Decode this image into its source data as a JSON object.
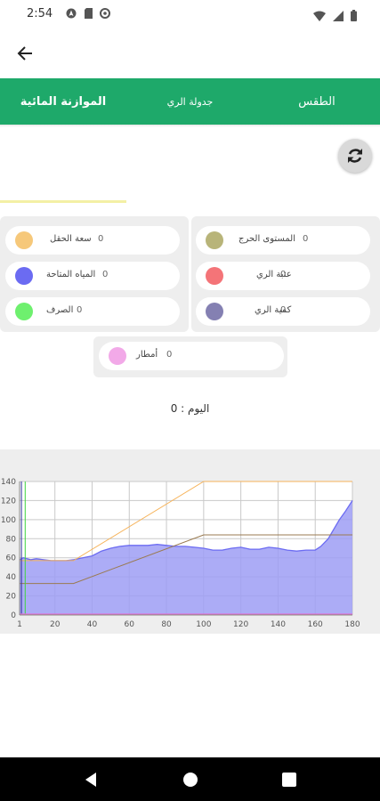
{
  "status_bar": {
    "time": "2:54"
  },
  "tabs": [
    {
      "label": "الموازنة المائية",
      "active": true
    },
    {
      "label": "جدولة الري",
      "active": false
    },
    {
      "label": "الطقس",
      "active": false
    }
  ],
  "legend": {
    "left": [
      {
        "label": "سعة الحقل",
        "value": "0",
        "color": "#f6c87a"
      },
      {
        "label": "المياه المتاحة",
        "value": "0",
        "color": "#6b6bf2"
      },
      {
        "label": "الصرف",
        "value": "0",
        "color": "#6ef06e"
      }
    ],
    "right": [
      {
        "label": "المستوى الحرج",
        "value": "0",
        "color": "#b8b479"
      },
      {
        "label": "عتبة الري",
        "value": "0",
        "color": "#f47478"
      },
      {
        "label": "كمية الري",
        "value": "0",
        "color": "#8480b2"
      }
    ],
    "bottom": {
      "label": "أمطار",
      "value": "0",
      "color": "#f2a9e8"
    }
  },
  "day_text": "اليوم : 0",
  "chart_data": {
    "type": "line",
    "title": "",
    "xlabel": "",
    "ylabel": "",
    "xlim": [
      1,
      180
    ],
    "ylim": [
      0,
      140
    ],
    "x_ticks": [
      "1",
      "20",
      "40",
      "60",
      "80",
      "100",
      "120",
      "140",
      "160",
      "180"
    ],
    "y_ticks": [
      "0",
      "20",
      "40",
      "60",
      "80",
      "100",
      "120",
      "140"
    ],
    "grid": true,
    "series": [
      {
        "name": "المياه المتاحة",
        "type": "area",
        "color": "#6b6bf2",
        "x": [
          1,
          3,
          5,
          7,
          10,
          14,
          18,
          22,
          26,
          30,
          35,
          40,
          45,
          50,
          55,
          60,
          65,
          70,
          75,
          80,
          85,
          90,
          95,
          100,
          105,
          110,
          115,
          120,
          125,
          130,
          135,
          140,
          145,
          150,
          155,
          160,
          163,
          167,
          170,
          173,
          176,
          180
        ],
        "y": [
          58,
          60,
          59,
          58,
          59,
          58,
          57,
          57,
          57,
          58,
          60,
          62,
          67,
          70,
          72,
          73,
          73,
          73,
          74,
          73,
          72,
          72,
          71,
          70,
          68,
          68,
          70,
          71,
          69,
          69,
          71,
          70,
          68,
          67,
          68,
          68,
          72,
          80,
          90,
          100,
          108,
          120
        ]
      },
      {
        "name": "سعة الحقل",
        "type": "line",
        "color": "#f6b35a",
        "x": [
          1,
          30,
          100,
          180
        ],
        "y": [
          57,
          57,
          140,
          140
        ]
      },
      {
        "name": "المستوى الحرج",
        "type": "line",
        "color": "#9a7a50",
        "x": [
          1,
          30,
          100,
          180
        ],
        "y": [
          33,
          33,
          84,
          84
        ]
      },
      {
        "name": "الصرف",
        "type": "line",
        "color": "#3ed43e",
        "x": [
          4,
          4
        ],
        "y": [
          0,
          140
        ]
      },
      {
        "name": "كمية الري",
        "type": "line",
        "color": "#2f2f9e",
        "x": [
          2,
          2
        ],
        "y": [
          0,
          140
        ]
      },
      {
        "name": "عتبة الري",
        "type": "line",
        "color": "#f47478",
        "x": [
          1,
          180
        ],
        "y": [
          0.5,
          0.5
        ]
      },
      {
        "name": "أمطار",
        "type": "line",
        "color": "#e070d8",
        "x": [
          1,
          180
        ],
        "y": [
          1,
          1
        ]
      }
    ]
  }
}
